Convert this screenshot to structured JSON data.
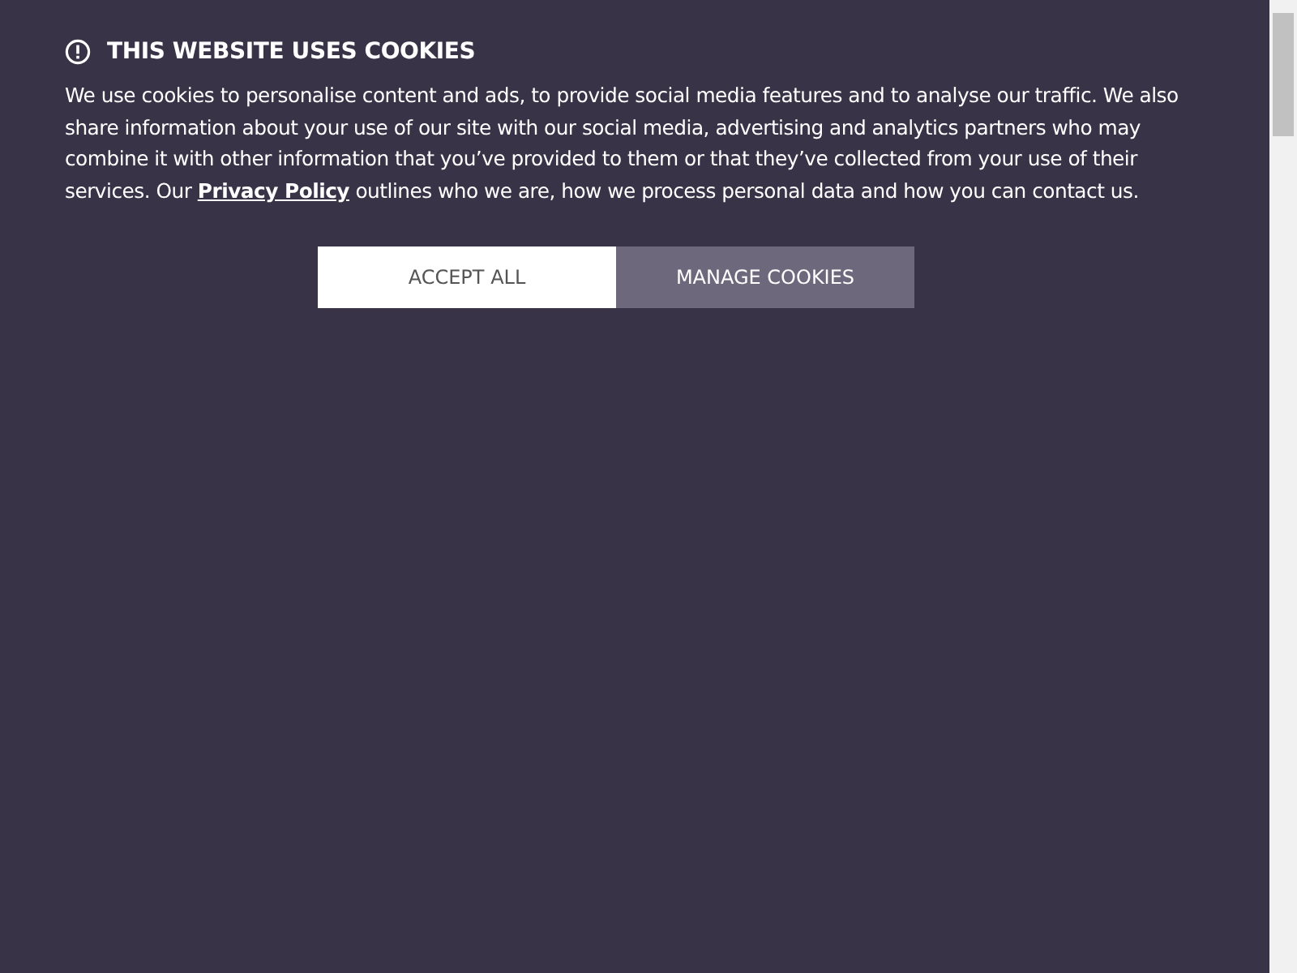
{
  "banner": {
    "title": "THIS WEBSITE USES COOKIES",
    "message": {
      "text_before": "We use cookies to personalise content and ads, to provide social media features and to analyse our traffic. We also share information about your use of our site with our social media, advertising and analytics partners who may combine it with other information that you’ve provided to them or that they’ve collected from your use of their services. Our",
      "link": "Privacy Policy",
      "text_after": "outlines who we are, how we process personal data and how you can contact us."
    },
    "buttons": [
      {
        "label": "ACCEPT ALL",
        "kind": "primary"
      },
      {
        "label": "MANAGE COOKIES",
        "kind": "secondary"
      }
    ]
  }
}
